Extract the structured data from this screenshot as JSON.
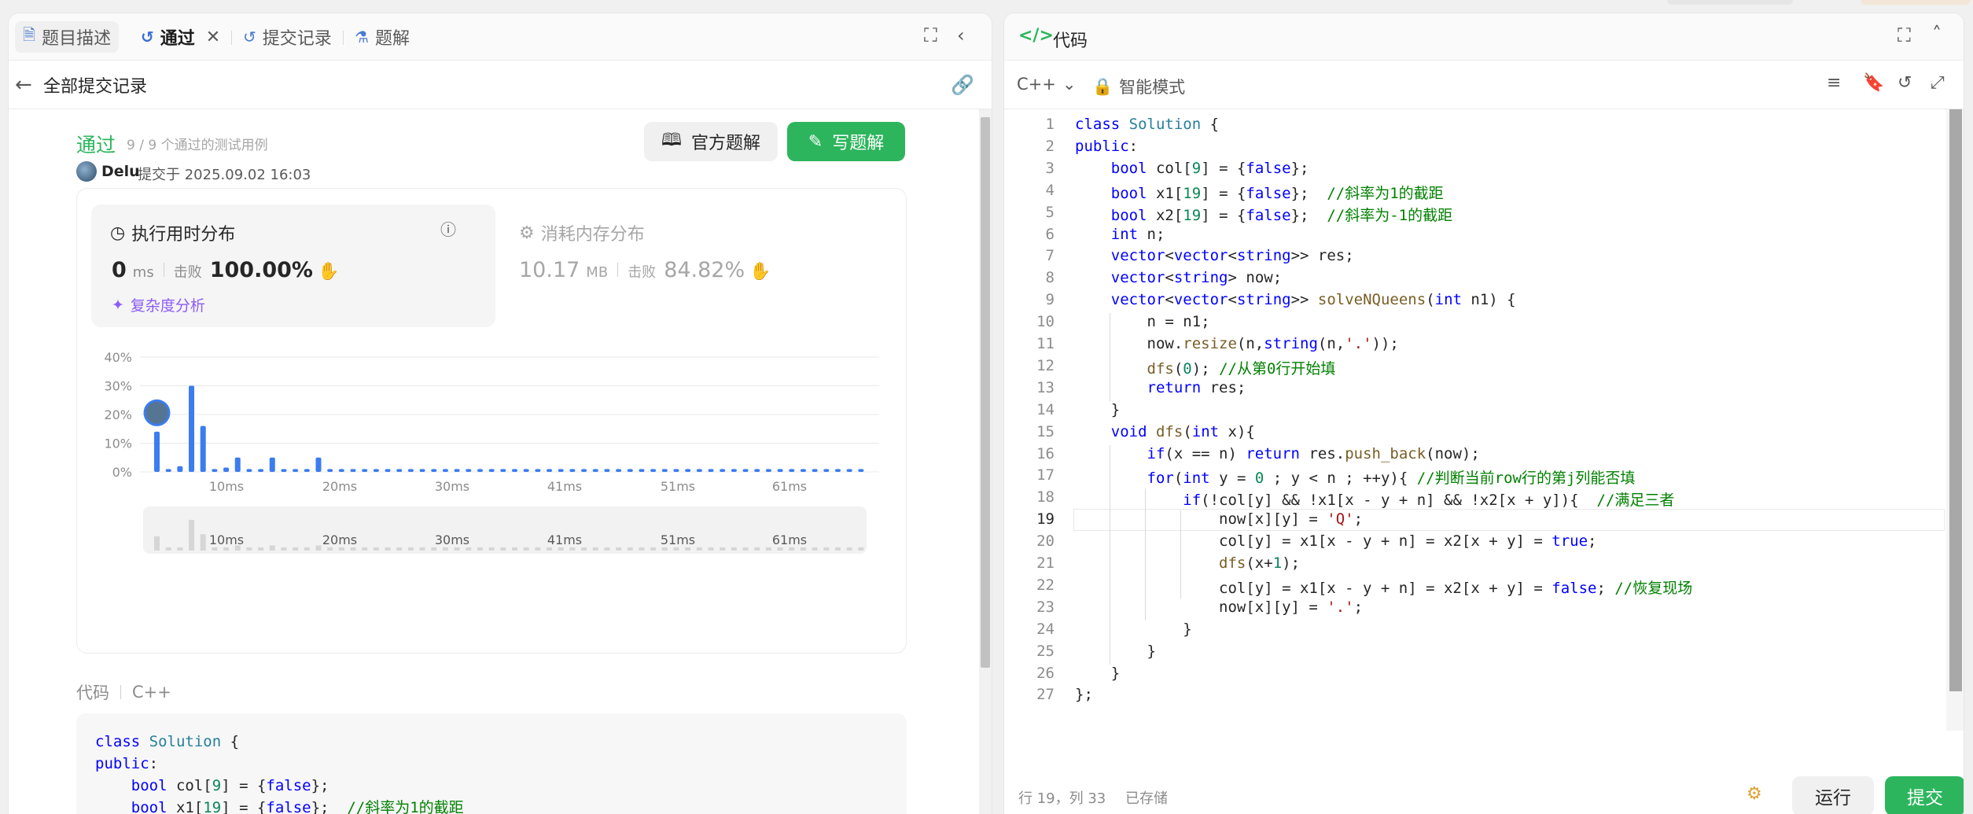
{
  "left_tabs": [
    {
      "label": "题目描述",
      "icon": "document-icon"
    },
    {
      "label": "通过",
      "icon": "history-icon"
    },
    {
      "label": "提交记录",
      "icon": "history-icon"
    },
    {
      "label": "题解",
      "icon": "flask-icon"
    }
  ],
  "back_label": "全部提交记录",
  "submission": {
    "status": "通过",
    "cases": "9 / 9 个通过的测试用例",
    "user": "Delu",
    "submitted_at": "提交于 2025.09.02 16:03"
  },
  "buttons": {
    "official": "官方题解",
    "write": "写题解"
  },
  "runtime": {
    "title": "执行用时分布",
    "value": "0",
    "unit": "ms",
    "beat_label": "击败",
    "beat": "100.00%",
    "analysis": "复杂度分析"
  },
  "memory": {
    "title": "消耗内存分布",
    "value": "10.17",
    "unit": "MB",
    "beat_label": "击败",
    "beat": "84.82%"
  },
  "code_section": {
    "label": "代码",
    "lang": "C++"
  },
  "chart_data": {
    "type": "bar",
    "ylabels": [
      "40%",
      "30%",
      "20%",
      "10%",
      "0%"
    ],
    "ylim": [
      0,
      40
    ],
    "xlabels": [
      "10ms",
      "20ms",
      "30ms",
      "41ms",
      "51ms",
      "61ms"
    ],
    "values": [
      14,
      1,
      2,
      30,
      16,
      1,
      1.5,
      5,
      1,
      1,
      5,
      1,
      1,
      1,
      5,
      1,
      1,
      1,
      1,
      1,
      1,
      1,
      1,
      1,
      1,
      1,
      1,
      1,
      1,
      1,
      1,
      1,
      1,
      1,
      1,
      1,
      1,
      1,
      1,
      1,
      1,
      1,
      1,
      1,
      1,
      1,
      1,
      1,
      1,
      1,
      1,
      1,
      1,
      1,
      1,
      1,
      1,
      1,
      1,
      1,
      1,
      1
    ],
    "highlight_index": 0,
    "bar_color": "#3b7cf0",
    "mini_xlabels": [
      "10ms",
      "20ms",
      "30ms",
      "41ms",
      "51ms",
      "61ms"
    ]
  },
  "editor": {
    "title": "代码",
    "lang": "C++",
    "mode": "智能模式",
    "status_pos": "行 19，列 33",
    "status_saved": "已存储",
    "run": "运行",
    "submit": "提交",
    "lines": [
      "class Solution {",
      "public:",
      "    bool col[9] = {false};",
      "    bool x1[19] = {false};  //斜率为1的截距",
      "    bool x2[19] = {false};  //斜率为-1的截距",
      "    int n;",
      "    vector<vector<string>> res;",
      "    vector<string> now;",
      "    vector<vector<string>> solveNQueens(int n1) {",
      "        n = n1;",
      "        now.resize(n,string(n,'.'));",
      "        dfs(0); //从第0行开始填",
      "        return res;",
      "    }",
      "    void dfs(int x){",
      "        if(x == n) return res.push_back(now);",
      "        for(int y = 0 ; y < n ; ++y){ //判断当前row行的第j列能否填",
      "            if(!col[y] && !x1[x - y + n] && !x2[x + y]){  //满足三者",
      "                now[x][y] = 'Q';",
      "                col[y] = x1[x - y + n] = x2[x + y] = true;",
      "                dfs(x+1);",
      "                col[y] = x1[x - y + n] = x2[x + y] = false; //恢复现场",
      "                now[x][y] = '.';",
      "            }",
      "        }",
      "    }",
      "};"
    ]
  },
  "preview_lines": [
    "class Solution {",
    "public:",
    "    bool col[9] = {false};",
    "    bool x1[19] = {false};  //斜率为1的截距"
  ],
  "colors": {
    "accent_green": "#2db55d",
    "bar_blue": "#3b7cf0",
    "purple": "#8b5cf6"
  }
}
